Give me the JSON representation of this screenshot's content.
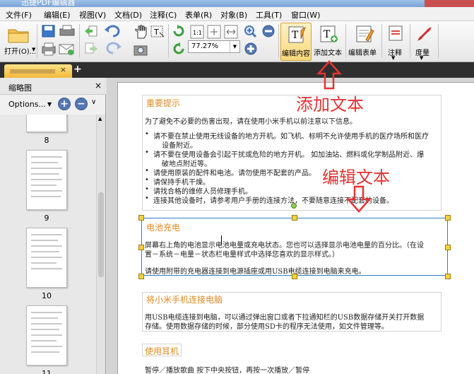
{
  "window": {
    "title": "迅捷PDF编辑器"
  },
  "menu": [
    "文件(F)",
    "编辑(E)",
    "视图(V)",
    "文档(D)",
    "注释(C)",
    "表单(R)",
    "对象(B)",
    "工具(T)",
    "窗口(W)"
  ],
  "toolbar": {
    "open_label": "打开(O)...",
    "zoom_value": "77.27%",
    "edit_content_label": "编辑内容",
    "add_text_label": "添加文本",
    "edit_form_label": "编辑表单",
    "annotate_label": "注释",
    "measure_label": "度量"
  },
  "tab": {
    "close": "×",
    "add": "+"
  },
  "panel": {
    "title": "缩略图",
    "close": "×",
    "options_label": "Options...",
    "pages": [
      "8",
      "9",
      "10",
      "11"
    ]
  },
  "document": {
    "section1": {
      "heading": "重要提示",
      "intro": "为了避免不必要的伤害出现，请在使用小米手机以前注意以下信息。",
      "bullets": [
        "请不要在禁止使用无线设备的地方开机。如飞机、标明不允许使用手机的医疗场所和医疗",
        "设备附近。",
        "请不要在使用设备会引起干扰或危险的地方开机。 如加油站、燃料或化学制品附近、爆",
        "破地点附近等。",
        "请使用原装的配件和电池。请勿使用不配套的产品。",
        "请保持手机干燥。",
        "请找合格的维修人员修理手机。",
        "连接其他设备时，请参考用户手册的连接方法，不要随意连接不配套的设备。"
      ]
    },
    "section2": {
      "heading": "电池充电",
      "para1a": "屏幕右上角的电池显示电池电量或充电状态。您也可以选择显示电池电量的百分比。（在设",
      "para1b": "置－系统－电量－状态栏电量样式中选择您喜欢的显示样式。）",
      "para2": "请使用附带的充电器连接到电源插座或用USB电缆连接到电脑来充电。"
    },
    "section3": {
      "heading": "将小米手机连接电脑",
      "para1": "用USB电缆连接到电脑，可以通过弹出窗口或者下拉通知栏的USB数据存储开关打开数据",
      "para2": "存储。使用数据存储的时候，部分使用SD卡的程序无法使用，如文件管理等。"
    },
    "section4": {
      "heading": "使用耳机",
      "para1": "暂停／播放歌曲            按下中央按钮，再按一次播放／暂停"
    }
  },
  "annotations": {
    "add_text": "添加文本",
    "edit_text": "编辑文本",
    "color": "#e53333"
  },
  "colors": {
    "accent": "#2f7ec8",
    "heading": "#e08a22",
    "tab": "#f2b93a"
  }
}
